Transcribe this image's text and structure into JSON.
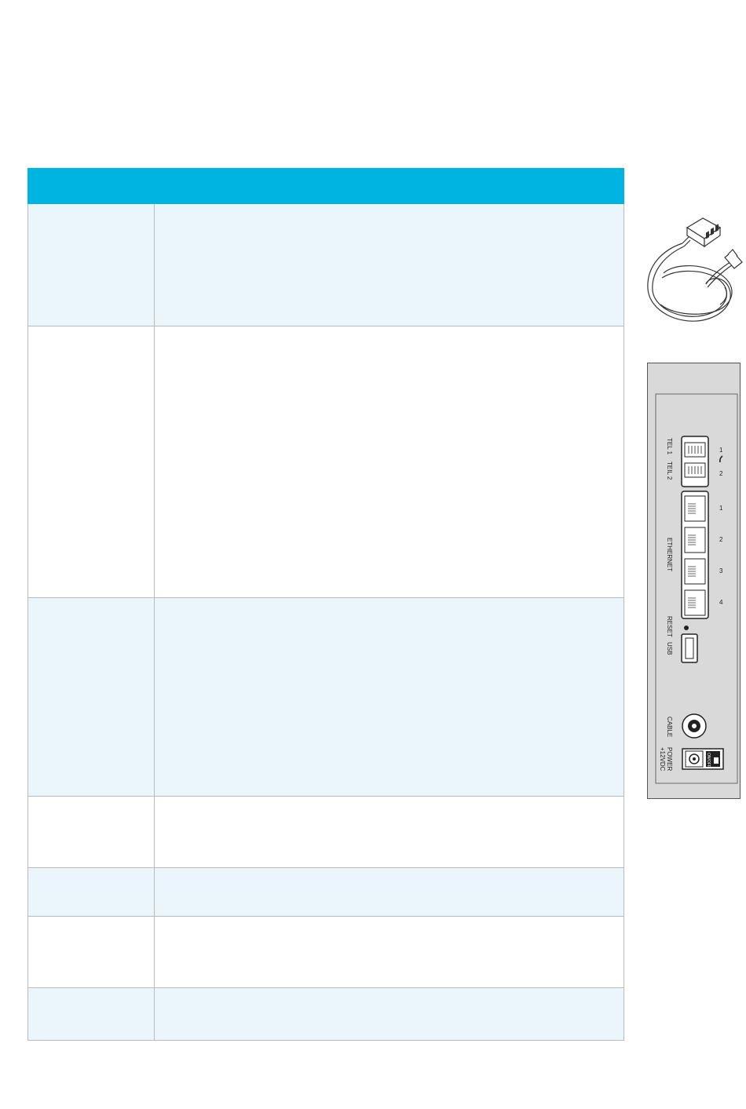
{
  "panel": {
    "tel1": "TEL 1",
    "tel2": "TEIL 2",
    "ethernet": "ETHERNET",
    "reset": "RESET",
    "usb": "USB",
    "cable": "CABLE",
    "power": "POWER",
    "power_voltage": "+12VDC",
    "switch": "ON/OFF",
    "tel_numbers": [
      "1",
      "2"
    ],
    "eth_numbers": [
      "1",
      "2",
      "3",
      "4"
    ]
  },
  "table": {
    "columns": 2,
    "rows": 7
  }
}
